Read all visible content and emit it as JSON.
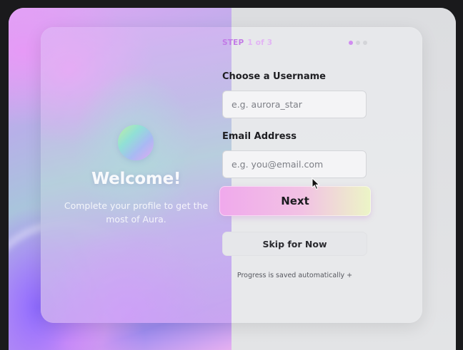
{
  "welcome": {
    "title": "Welcome!",
    "subtitle": "Complete your profile to get the most of Aura."
  },
  "step": {
    "label": "STEP",
    "count": "1 of 3",
    "current": 1,
    "total": 3
  },
  "form": {
    "username": {
      "label": "Choose a Username",
      "placeholder": "e.g. aurora_star",
      "value": ""
    },
    "email": {
      "label": "Email Address",
      "placeholder": "e.g. you@email.com",
      "value": ""
    }
  },
  "buttons": {
    "next": "Next",
    "skip": "Skip for Now"
  },
  "footer": {
    "note": "Progress is saved automatically +"
  },
  "colors": {
    "accent": "#c27ae6",
    "next_gradient_start": "#f0a9ec",
    "next_gradient_end": "#ecf5c6"
  },
  "icons": {
    "logo": "gradient-orb",
    "cursor": "arrow-pointer"
  }
}
